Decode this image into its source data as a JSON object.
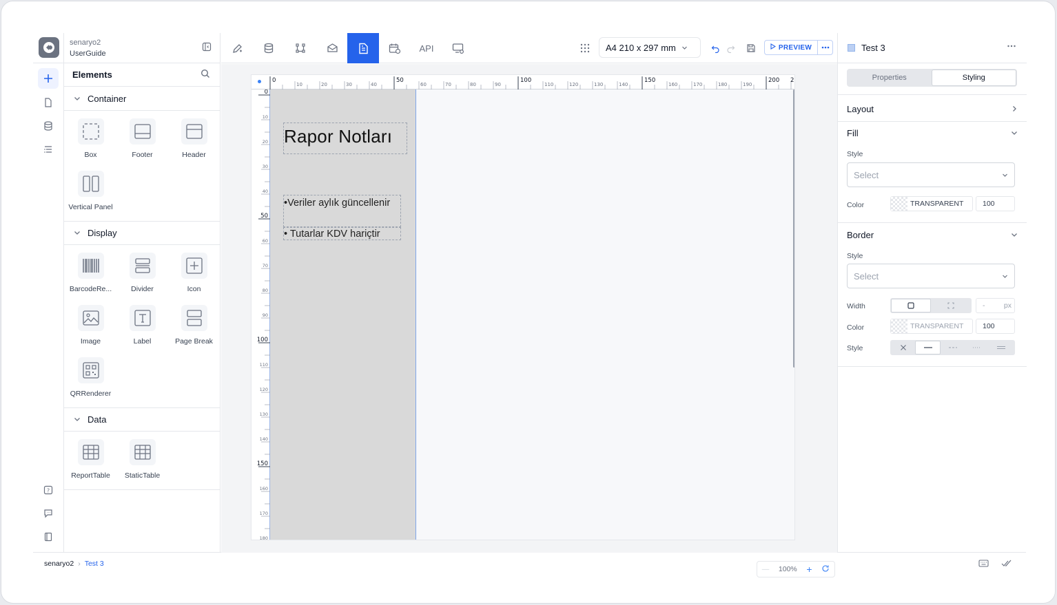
{
  "project": {
    "name": "senaryo2",
    "sub": "UserGuide"
  },
  "elements_panel": {
    "title": "Elements",
    "sections": [
      {
        "label": "Container",
        "items": [
          "Box",
          "Footer",
          "Header",
          "Vertical Panel"
        ]
      },
      {
        "label": "Display",
        "items": [
          "BarcodeRe...",
          "Divider",
          "Icon",
          "Image",
          "Label",
          "Page Break",
          "QRRenderer"
        ]
      },
      {
        "label": "Data",
        "items": [
          "ReportTable",
          "StaticTable"
        ]
      }
    ]
  },
  "toolbar": {
    "api_label": "API",
    "page_size": "A4 210 x 297 mm",
    "preview_label": "PREVIEW"
  },
  "ruler": {
    "h_major": [
      "0",
      "50",
      "100",
      "150",
      "200",
      "2"
    ],
    "h_minor": [
      "10",
      "20",
      "30",
      "40",
      "60",
      "70",
      "80",
      "90",
      "110",
      "120",
      "130",
      "140",
      "160",
      "170",
      "180",
      "190"
    ],
    "v_major": [
      "0",
      "50",
      "100",
      "150"
    ],
    "v_minor": [
      "10",
      "20",
      "30",
      "40",
      "60",
      "70",
      "80",
      "90",
      "110",
      "120",
      "130",
      "140",
      "160",
      "170",
      "180"
    ]
  },
  "document": {
    "title": "Rapor Notları",
    "bullet1": "•Veriler aylık güncellenir",
    "bullet2": "• Tutarlar KDV hariçtir"
  },
  "zoom": {
    "minus": "—",
    "value": "100%",
    "plus": "+"
  },
  "right_panel": {
    "header": "Test 3",
    "tabs": [
      "Properties",
      "Styling"
    ],
    "active_tab": "Styling",
    "layout_label": "Layout",
    "fill": {
      "label": "Fill",
      "style_label": "Style",
      "style_placeholder": "Select",
      "color_label": "Color",
      "color_value": "TRANSPARENT",
      "opacity": "100"
    },
    "border": {
      "label": "Border",
      "style_label": "Style",
      "style_placeholder": "Select",
      "width_label": "Width",
      "width_value": "-",
      "width_unit": "px",
      "color_label": "Color",
      "color_value": "TRANSPARENT",
      "opacity": "100",
      "line_style_label": "Style"
    }
  },
  "breadcrumb": {
    "root": "senaryo2",
    "separator": "›",
    "current": "Test 3"
  },
  "colors": {
    "accent": "#2563eb",
    "page": "#d9d9d9"
  }
}
